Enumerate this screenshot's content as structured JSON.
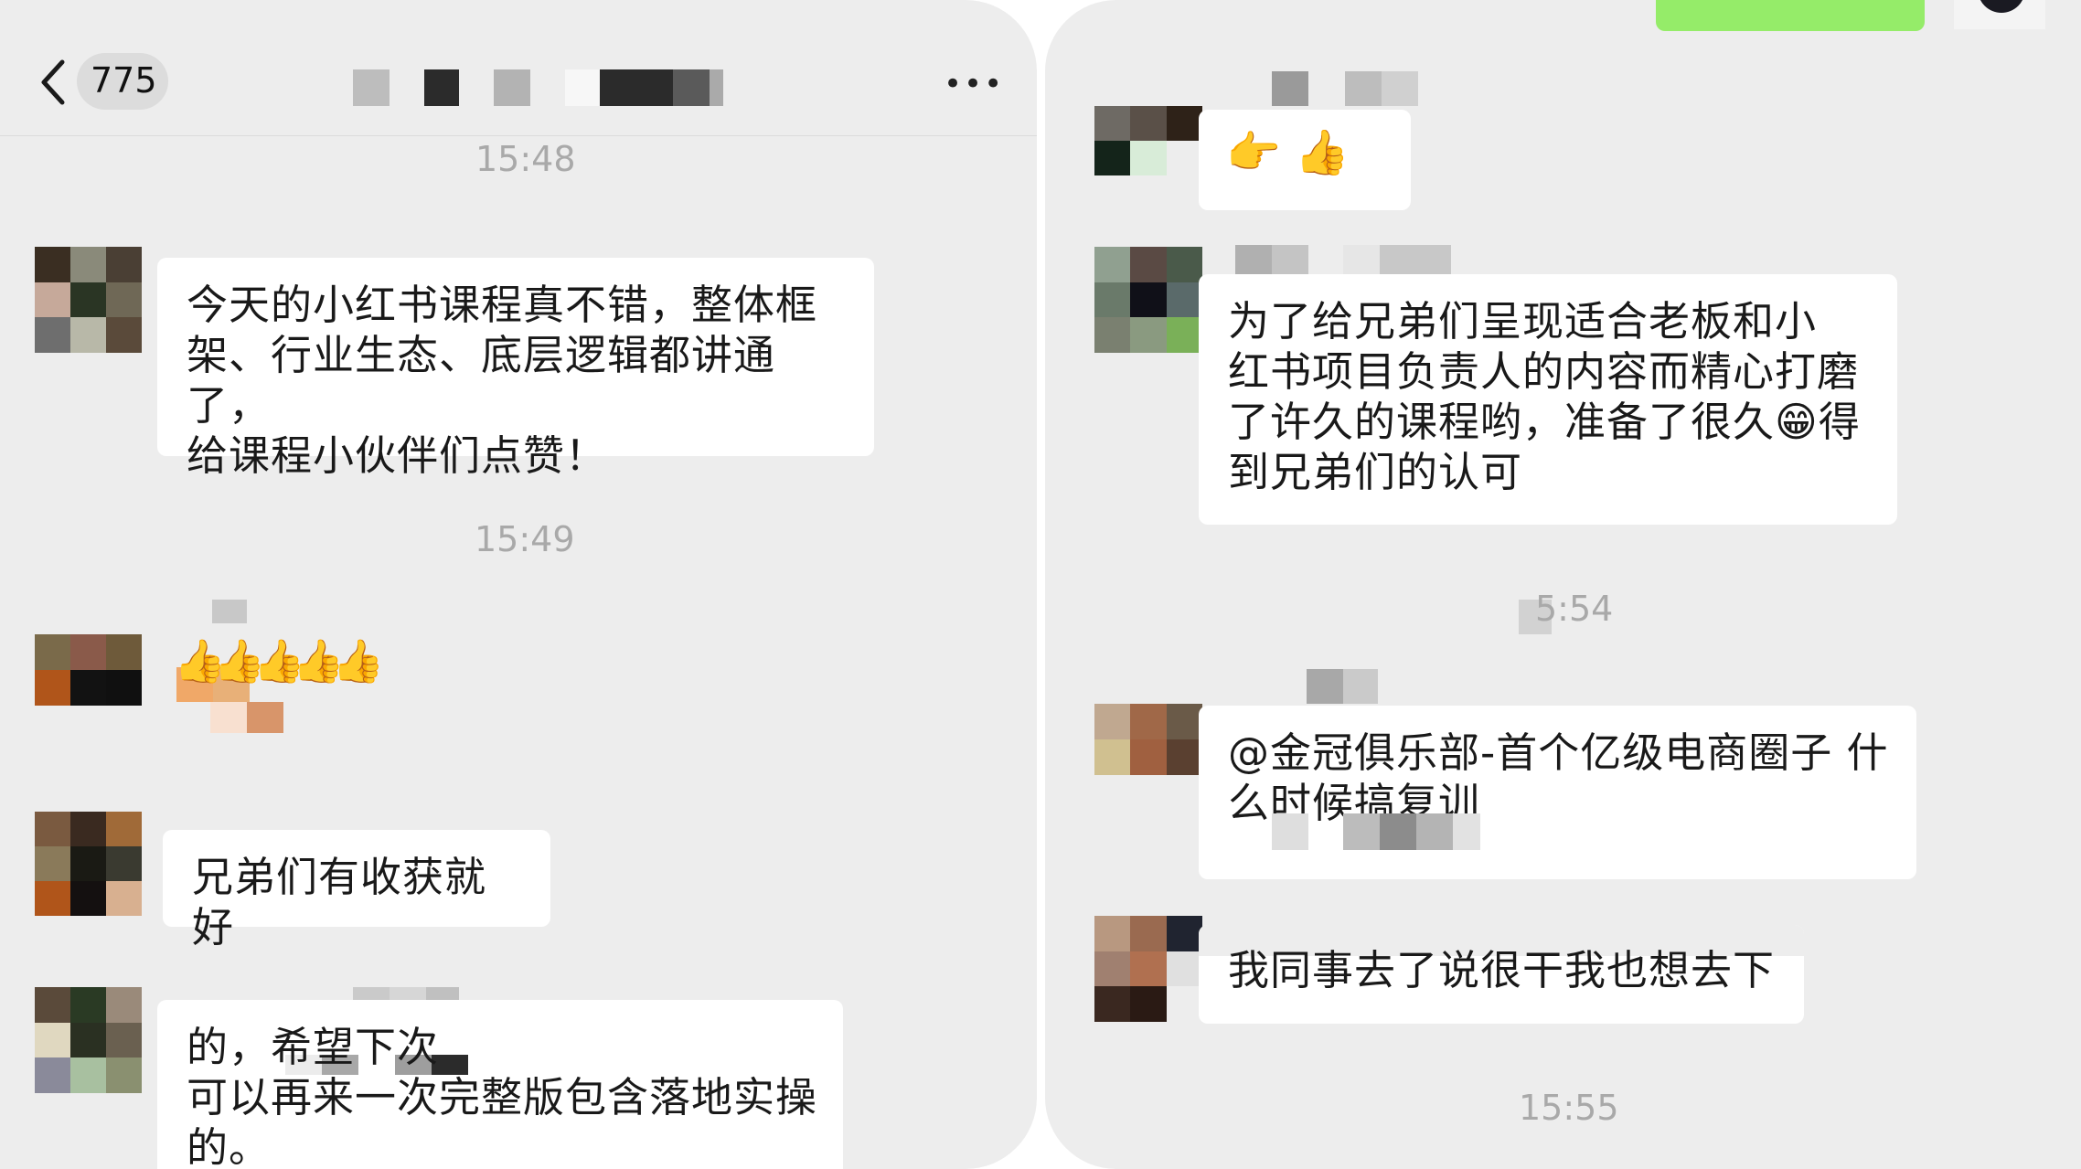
{
  "header": {
    "back_count": "775",
    "more_label": "•••"
  },
  "left": {
    "time1": "15:48",
    "msg1": "今天的小红书课程真不错，整体框\n架、行业生态、底层逻辑都讲通了，\n给课程小伙伴们点赞！",
    "time2": "15:49",
    "emoji_msg": "👍👍👍👍👍",
    "msg3": "兄弟们有收获就好",
    "msg4": "的，希望下次\n可以再来一次完整版包含落地实操\n的。"
  },
  "right": {
    "emoji_msg": "👉 👍",
    "msg1": "为了给兄弟们呈现适合老板和小\n红书项目负责人的内容而精心打磨\n了许久的课程哟，准备了很久😁得\n到兄弟们的认可",
    "time1": "5:54",
    "msg2": "@金冠俱乐部-首个亿级电商圈子 什\n么时候搞复训",
    "msg3": "我同事去了说很干我也想去下",
    "time2": "15:55"
  },
  "colors": {
    "background": "#ededed",
    "bubble": "#ffffff",
    "sent_bubble": "#95ec69",
    "timestamp": "#a9a9a9"
  },
  "icons": [
    "back-chevron-icon",
    "more-icon"
  ]
}
